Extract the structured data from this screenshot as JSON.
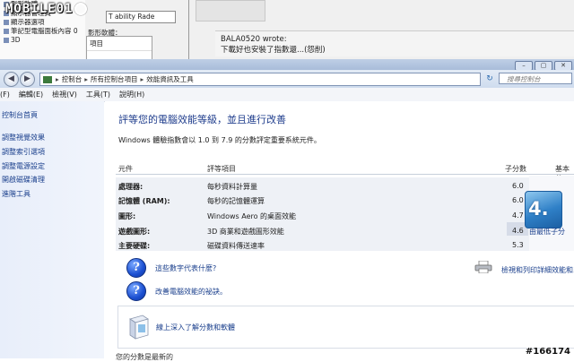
{
  "background": {
    "left_items": [
      "影形軟體",
      "顯示器管理員",
      "顯示器選項",
      "筆記型電腦面板內容 0",
      "3D"
    ],
    "combo_value": "T  ability Rade",
    "group_label": "影形軟體：",
    "group_item": "項目",
    "quote_author": "BALA0520 wrote:",
    "quote_text": "下載好也安裝了指數還...(怨削)"
  },
  "logo_text": "MOBILE01",
  "window_controls": [
    "–",
    "▢",
    "✕"
  ],
  "address": {
    "crumbs": [
      "控制台",
      "所有控制台項目",
      "效能資訊及工具"
    ],
    "search_placeholder": "搜尋控制台"
  },
  "menu": [
    "(F)",
    "編輯(E)",
    "檢視(V)",
    "工具(T)",
    "說明(H)"
  ],
  "sidebar": {
    "items": [
      "控制台首頁",
      "調整視覺效果",
      "調整索引選項",
      "調整電源設定",
      "開啟磁碟清理",
      "進階工具"
    ]
  },
  "main": {
    "title": "評等您的電腦效能等級，並且進行改善",
    "description": "Windows 體驗指數會以 1.0 到 7.9 的分數評定重要系統元件。",
    "headers": {
      "component": "元件",
      "item": "評等項目",
      "subscore": "子分數",
      "base": "基本分"
    },
    "rows": [
      {
        "component": "處理器:",
        "desc": "每秒資料計算量",
        "score": "6.0"
      },
      {
        "component": "記憶體 (RAM):",
        "desc": "每秒的記憶體運算",
        "score": "6.0"
      },
      {
        "component": "圖形:",
        "desc": "Windows Aero 的桌面效能",
        "score": "4.7"
      },
      {
        "component": "遊戲圖形:",
        "desc": "3D 商業和遊戲圖形效能",
        "score": "4.6"
      },
      {
        "component": "主要硬碟:",
        "desc": "磁碟資料傳送速率",
        "score": "5.3"
      }
    ],
    "base_score": "4.",
    "base_caption": "由最低子分",
    "help_links": [
      "這些數字代表什麼?",
      "改善電腦效能的祕訣。"
    ],
    "print_link": "檢視和列印詳細效能和系統",
    "learn_more": "線上深入了解分數和軟體",
    "bottom_text": "您的分數是最新的"
  },
  "watermark": "#166174"
}
